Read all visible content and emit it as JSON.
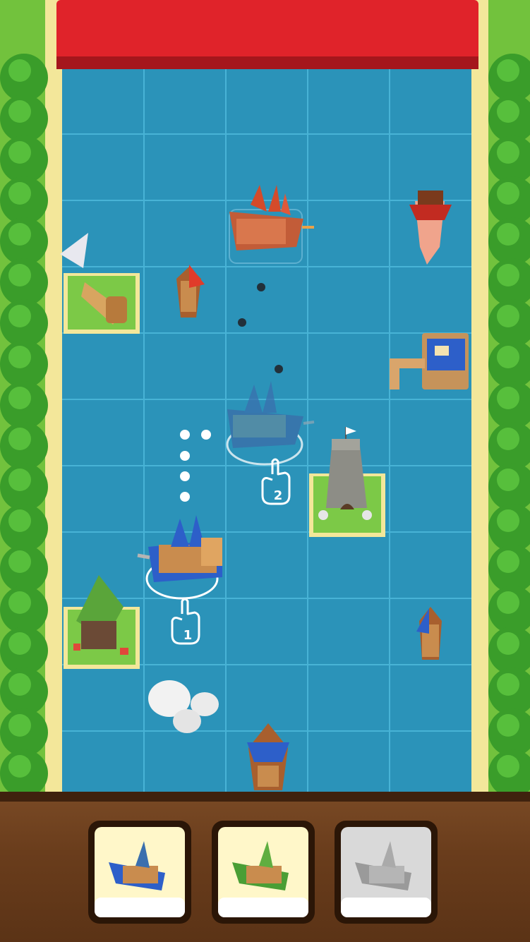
{
  "colors": {
    "water": "#2b93b9",
    "grid_line": "#48b3d6",
    "grass": "#72c23d",
    "sand": "#f3e79a",
    "tree": "#3a9d2a",
    "top_wall": "#e0232a",
    "tray_wood": "#6a3d1c",
    "card_bg": "#fff7c9",
    "player_blue": "#2d5fc9",
    "enemy_red": "#d44b2a"
  },
  "tutorial": {
    "step_one": "1",
    "step_two": "2"
  },
  "cards": [
    {
      "name": "blue-ship-card",
      "ship_color": "#2d5fc9",
      "label": "",
      "enabled": true
    },
    {
      "name": "green-ship-card",
      "ship_color": "#4a9e35",
      "label": "",
      "enabled": true
    },
    {
      "name": "grey-ship-card",
      "ship_color": "#9a9a9a",
      "label": "",
      "enabled": false
    }
  ],
  "board": {
    "cols": 5,
    "rows": 11
  }
}
